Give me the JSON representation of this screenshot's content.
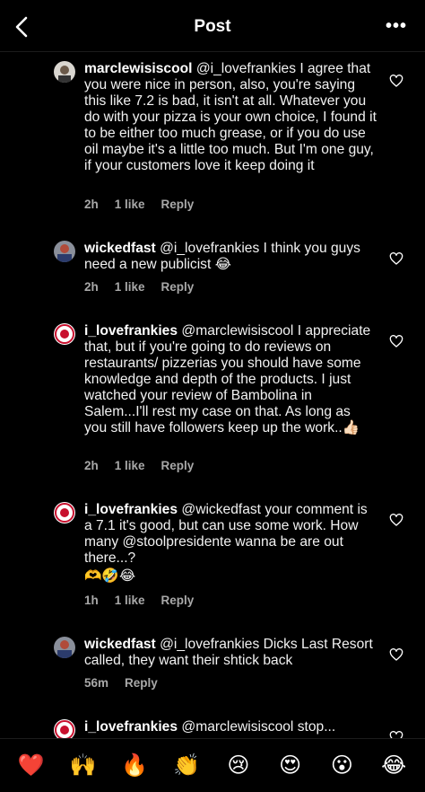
{
  "header": {
    "title": "Post"
  },
  "comments": [
    {
      "username": "marclewisiscool",
      "text": "@i_lovefrankies I agree that you were nice in person, also, you're saying this like 7.2 is bad, it isn't at all. Whatever you do with your pizza is your own choice, I found it to be either too much grease, or if you do use oil maybe it's a little too much. But I'm one guy, if your customers love it keep doing it",
      "time": "2h",
      "likes": "1 like",
      "reply": "Reply"
    },
    {
      "username": "wickedfast",
      "text": "@i_lovefrankies I think you guys need a new publicist 😂",
      "time": "2h",
      "likes": "1 like",
      "reply": "Reply"
    },
    {
      "username": "i_lovefrankies",
      "text": "@marclewisiscool I appreciate that, but if you're going to do reviews on restaurants/ pizzerias you should have some knowledge and depth of the products. I just watched your review of Bambolina in Salem...I'll rest my case on that. As long as you still have followers keep up the work..👍🏻",
      "time": "2h",
      "likes": "1 like",
      "reply": "Reply"
    },
    {
      "username": "i_lovefrankies",
      "text": "@wickedfast your comment is a 7.1 it's good, but can use some work. How many @stoolpresidente wanna be are out there...?",
      "text2": "🫶🤣😂",
      "time": "1h",
      "likes": "1 like",
      "reply": "Reply"
    },
    {
      "username": "wickedfast",
      "text": "@i_lovefrankies Dicks Last Resort called, they want their shtick back",
      "time": "56m",
      "reply": "Reply"
    },
    {
      "username": "i_lovefrankies",
      "text": "@marclewisiscool  stop..."
    }
  ],
  "emoji_bar": [
    "❤️",
    "🙌",
    "🔥",
    "👏",
    "😢",
    "😍",
    "😮",
    "😂"
  ]
}
